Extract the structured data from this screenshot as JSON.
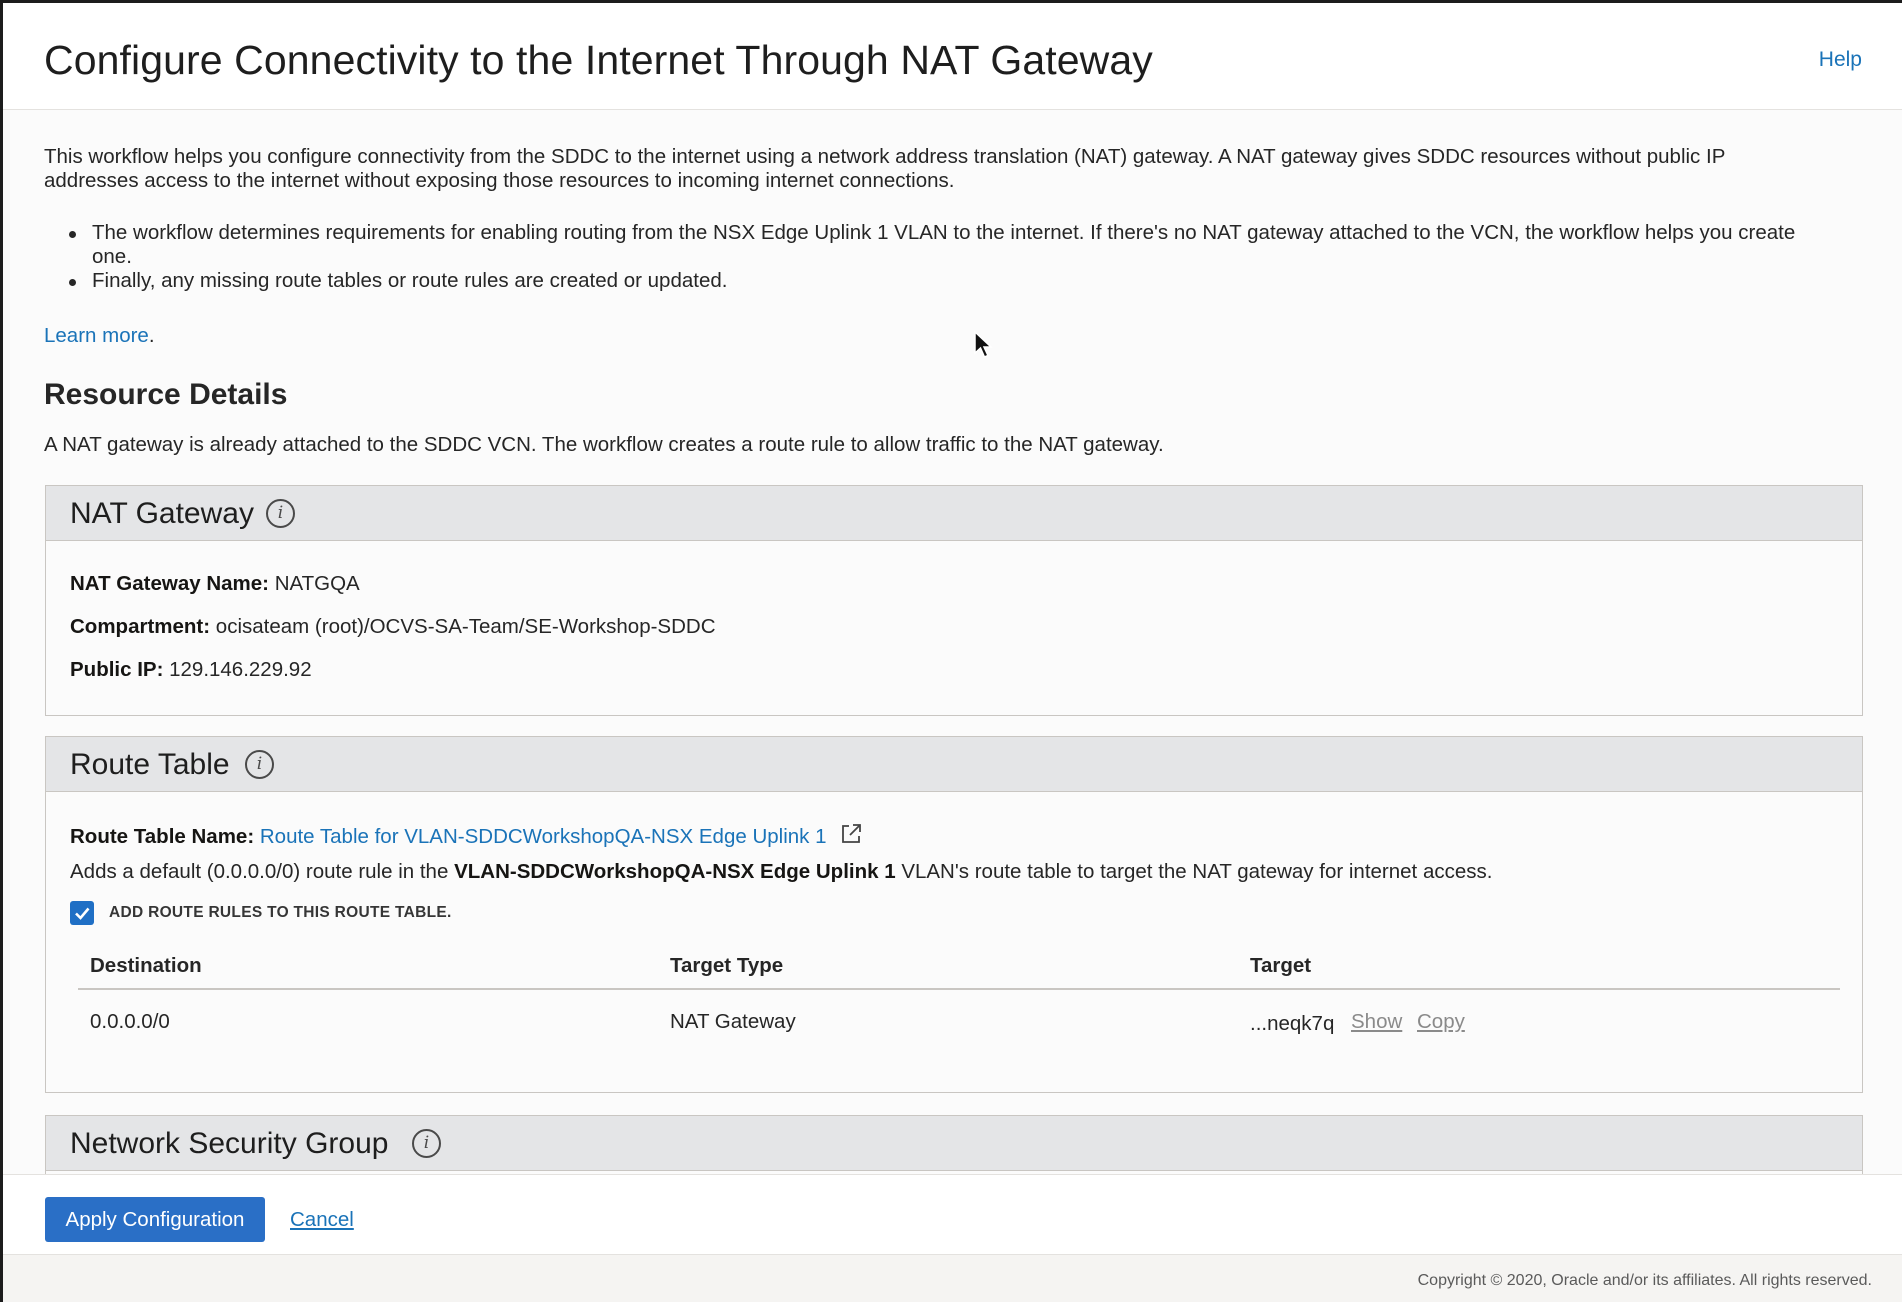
{
  "header": {
    "title": "Configure Connectivity to the Internet Through NAT Gateway",
    "help_label": "Help"
  },
  "intro": {
    "line1": "This workflow helps you configure connectivity from the SDDC to the internet using a network address translation (NAT) gateway. A NAT gateway gives SDDC resources without public IP",
    "line2": "addresses access to the internet without exposing those resources to incoming internet connections.",
    "bullets": [
      {
        "line1": "The workflow determines requirements for enabling routing from the NSX Edge Uplink 1 VLAN to the internet. If there's no NAT gateway attached to the VCN, the workflow helps you create",
        "line2": "one."
      },
      {
        "line1": "Finally, any missing route tables or route rules are created or updated."
      }
    ],
    "learn_more": "Learn more",
    "learn_more_period": "."
  },
  "resource_details": {
    "title": "Resource Details",
    "description": "A NAT gateway is already attached to the SDDC VCN. The workflow creates a route rule to allow traffic to the NAT gateway."
  },
  "nat_gateway": {
    "title": "NAT Gateway",
    "name_label": "NAT Gateway Name:",
    "name_value": "NATGQA",
    "compartment_label": "Compartment:",
    "compartment_value": "ocisateam (root)/OCVS-SA-Team/SE-Workshop-SDDC",
    "public_ip_label": "Public IP:",
    "public_ip_value": "129.146.229.92"
  },
  "route_table": {
    "title": "Route Table",
    "name_label": "Route Table Name:",
    "name_link": "Route Table for VLAN-SDDCWorkshopQA-NSX Edge Uplink 1",
    "desc_prefix": "Adds a default (0.0.0.0/0) route rule in the",
    "desc_bold": "VLAN-SDDCWorkshopQA-NSX Edge Uplink 1",
    "desc_suffix": "VLAN's route table to target the NAT gateway for internet access.",
    "checkbox_label": "ADD ROUTE RULES TO THIS ROUTE TABLE.",
    "checkbox_checked": true,
    "columns": [
      "Destination",
      "Target Type",
      "Target"
    ],
    "rows": [
      {
        "destination": "0.0.0.0/0",
        "target_type": "NAT Gateway",
        "target": "...neqk7q",
        "show_label": "Show",
        "copy_label": "Copy"
      }
    ]
  },
  "nsg": {
    "title": "Network Security Group"
  },
  "footer": {
    "apply_label": "Apply Configuration",
    "cancel_label": "Cancel",
    "copyright": "Copyright © 2020, Oracle and/or its affiliates. All rights reserved."
  },
  "colors": {
    "link": "#1a73b8",
    "primary_button": "#2a6fc6",
    "card_header": "#e4e5e7"
  }
}
